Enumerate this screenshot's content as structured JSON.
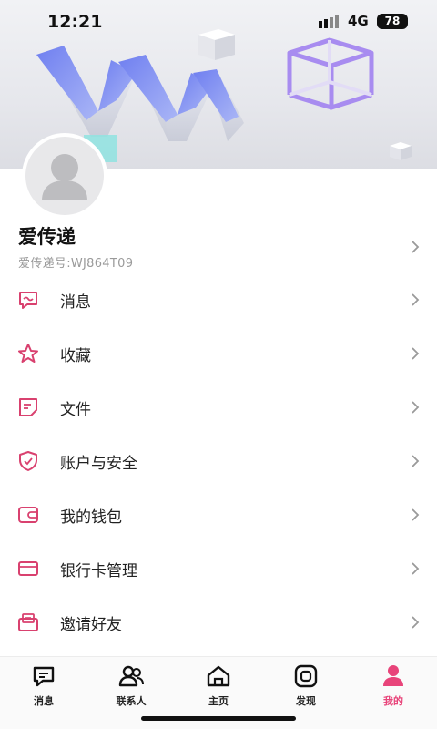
{
  "status_bar": {
    "time": "12:21",
    "network": "4G",
    "battery": "78"
  },
  "profile": {
    "name": "爱传递",
    "id_line": "爱传递号:WJ864T09"
  },
  "menu": [
    {
      "label": "消息",
      "icon": "message-bubble-icon"
    },
    {
      "label": "收藏",
      "icon": "star-icon"
    },
    {
      "label": "文件",
      "icon": "file-icon"
    },
    {
      "label": "账户与安全",
      "icon": "shield-check-icon"
    },
    {
      "label": "我的钱包",
      "icon": "wallet-icon"
    },
    {
      "label": "银行卡管理",
      "icon": "bank-card-icon"
    },
    {
      "label": "邀请好友",
      "icon": "invite-mail-icon"
    }
  ],
  "tabs": [
    {
      "label": "消息",
      "icon": "chat-icon"
    },
    {
      "label": "联系人",
      "icon": "contacts-icon"
    },
    {
      "label": "主页",
      "icon": "home-icon"
    },
    {
      "label": "发现",
      "icon": "discover-icon"
    },
    {
      "label": "我的",
      "icon": "me-icon",
      "active": true
    }
  ],
  "colors": {
    "accent": "#e8447a",
    "icon_stroke": "#d9416f"
  }
}
